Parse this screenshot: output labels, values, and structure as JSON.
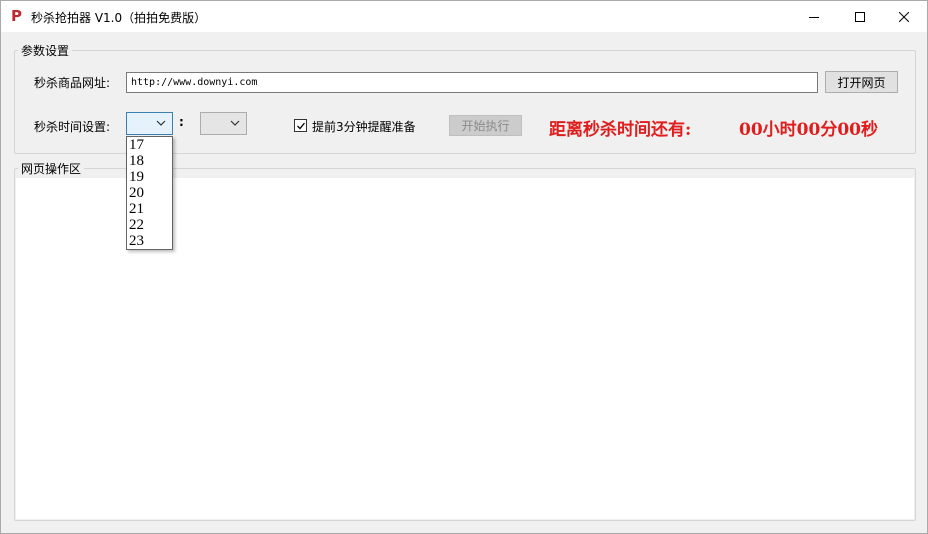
{
  "window": {
    "title": "秒杀抢拍器 V1.0（拍拍免费版）",
    "icon": "app-p-icon",
    "controls": [
      "minimize-icon",
      "maximize-icon",
      "close-icon"
    ]
  },
  "params_group": {
    "caption": "参数设置",
    "url_label": "秒杀商品网址:",
    "url_value": "http://www.downyi.com",
    "open_button": "打开网页",
    "time_label": "秒杀时间设置:",
    "colon": ":",
    "hour_selected": "",
    "minute_selected": "",
    "hour_options": [
      "17",
      "18",
      "19",
      "20",
      "21",
      "22",
      "23"
    ],
    "reminder_checked": true,
    "reminder_label": "提前3分钟提醒准备",
    "start_button": "开始执行",
    "countdown_label": "距离秒杀时间还有:",
    "countdown_value": "00小时00分00秒"
  },
  "web_group": {
    "caption": "网页操作区"
  },
  "colors": {
    "countdown": "#e01d1d",
    "window_bg": "#f0f0f0",
    "focus_border": "#3c7fb1"
  }
}
